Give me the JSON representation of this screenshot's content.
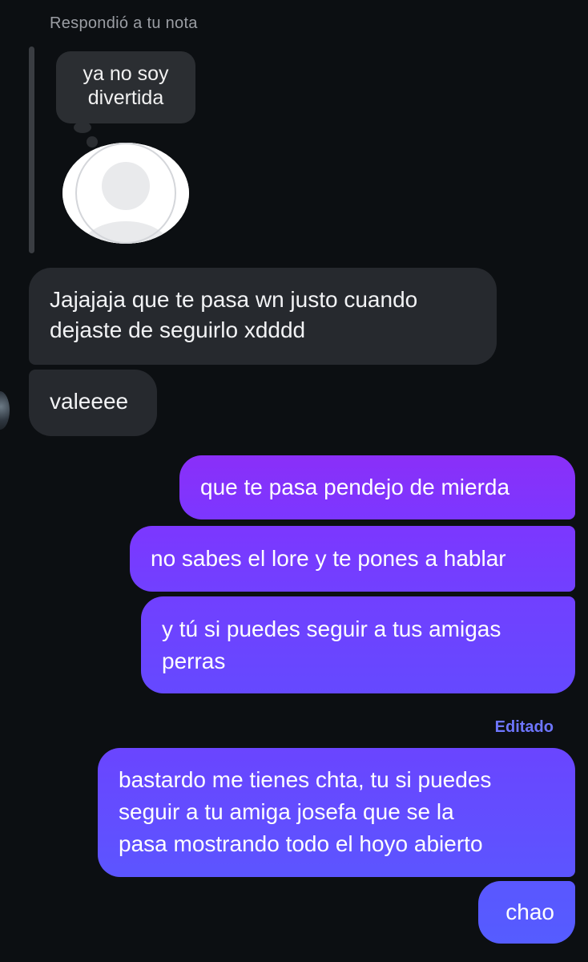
{
  "reply_header": "Respondió a tu nota",
  "note": {
    "text": "ya no soy\ndivertida"
  },
  "messages": [
    {
      "side": "received",
      "text": "Jajajaja que te pasa wn justo cuando\ndejaste de seguirlo xdddd"
    },
    {
      "side": "received",
      "text": "valeeee"
    },
    {
      "side": "sent",
      "text": "que te pasa pendejo de mierda"
    },
    {
      "side": "sent",
      "text": "no sabes el lore y te pones a hablar"
    },
    {
      "side": "sent",
      "text": "y tú si puedes seguir a tus amigas\nperras"
    },
    {
      "side": "sent",
      "text": "bastardo me tienes chta, tu si puedes\nseguir a tu amiga josefa que se la\npasa mostrando todo el hoyo abierto",
      "edited_label": "Editado"
    },
    {
      "side": "sent",
      "text": "chao"
    }
  ],
  "colors": {
    "background": "#0c0f12",
    "received_bubble": "#26292e",
    "sent_gradient_top": "#8a2ff8",
    "sent_gradient_bottom": "#555cff",
    "edited_label": "#6e76ff"
  },
  "icons": {
    "note_avatar": "default-user-avatar-icon",
    "sender_avatar": "user-avatar-icon"
  }
}
